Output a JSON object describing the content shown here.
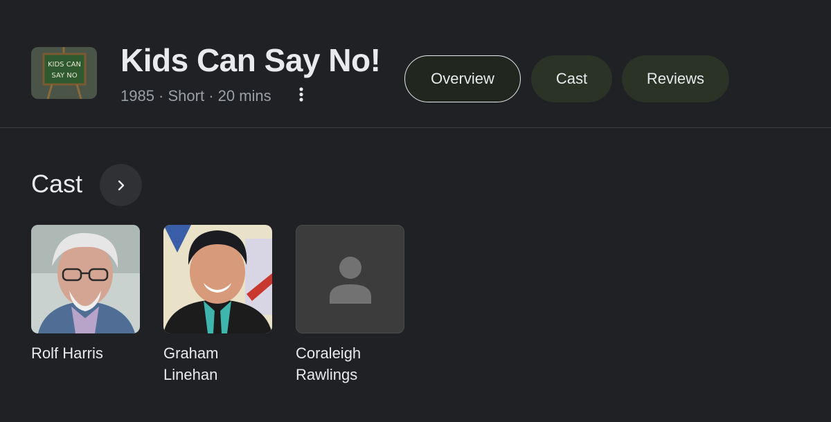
{
  "header": {
    "title": "Kids Can Say No!",
    "meta": "1985 · Short · 20 mins",
    "thumbnail_text": "KIDS CAN SAY NO",
    "more_icon": "more-vert-icon"
  },
  "tabs": [
    {
      "label": "Overview",
      "active": true
    },
    {
      "label": "Cast",
      "active": false
    },
    {
      "label": "Reviews",
      "active": false
    }
  ],
  "cast_section": {
    "title": "Cast",
    "arrow_icon": "chevron-right-icon"
  },
  "cast": [
    {
      "name": "Rolf Harris",
      "photo": "photo"
    },
    {
      "name": "Graham Linehan",
      "photo": "photo"
    },
    {
      "name": "Coraleigh Rawlings",
      "photo": "person-placeholder-icon"
    }
  ],
  "colors": {
    "background": "#202124",
    "tab_bg": "#2a3325",
    "text": "#e8eaed",
    "muted": "#9aa0a6"
  }
}
